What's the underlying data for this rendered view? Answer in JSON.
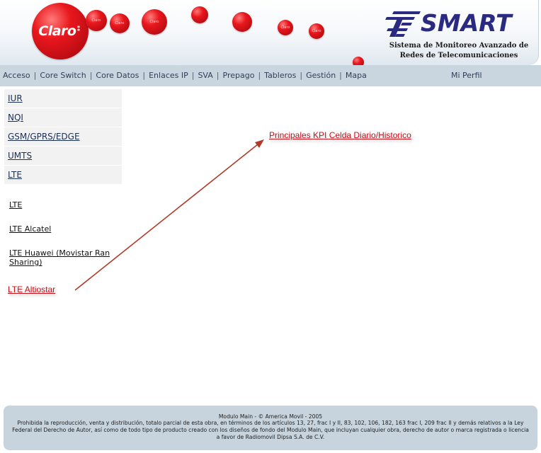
{
  "header": {
    "claro_logo_text": "Claro",
    "claro_ball_text": "Claro",
    "smart_logo_text": "SMART",
    "subtitle_line1": "Sistema de Monitoreo Avanzado de",
    "subtitle_line2": "Redes de Telecomunicaciones"
  },
  "nav": {
    "items": [
      "Acceso",
      "Core Switch",
      "Core Datos",
      "Enlaces IP",
      "SVA",
      "Prepago",
      "Tableros",
      "Gestión",
      "Mapa"
    ],
    "separator": "|",
    "profile": "Mi Perfil"
  },
  "side_menu": {
    "items": [
      "IUR",
      "NQI",
      "GSM/GPRS/EDGE",
      "UMTS",
      "LTE"
    ]
  },
  "sub_menu": {
    "items": [
      "LTE",
      "LTE Alcatel",
      "LTE Huawei (Movistar Ran Sharing)"
    ]
  },
  "highlights": {
    "lte_altiostar": "LTE Altiostar",
    "kpi_link": "Principales KPI Celda Diario/Historico"
  },
  "footer": {
    "line1": "Modulo Main - © America Movil - 2005",
    "line2": "Prohibida la reproducción, venta y distribución, totalo parcial de esta obra, en términos de los artículos 13, 27, frac I y II, 83, 102, 106, 182, 163 frac I, 209 frac II y demás relativos a la Ley Federal del Derecho de Autor, así como de todo tipo de producto creado con los diseños de fondo del Modulo Main, que incluyan cualquier obra, derecho de autor o marca registrada o licencia a favor de Radiomovil Dipsa S.A. de C.V."
  },
  "colors": {
    "claro_red": "#e8171d",
    "smart_blue": "#2a2a80",
    "nav_bg": "#c9d6e0",
    "highlight_red": "#c8101b",
    "arrow": "#b03a2a"
  }
}
